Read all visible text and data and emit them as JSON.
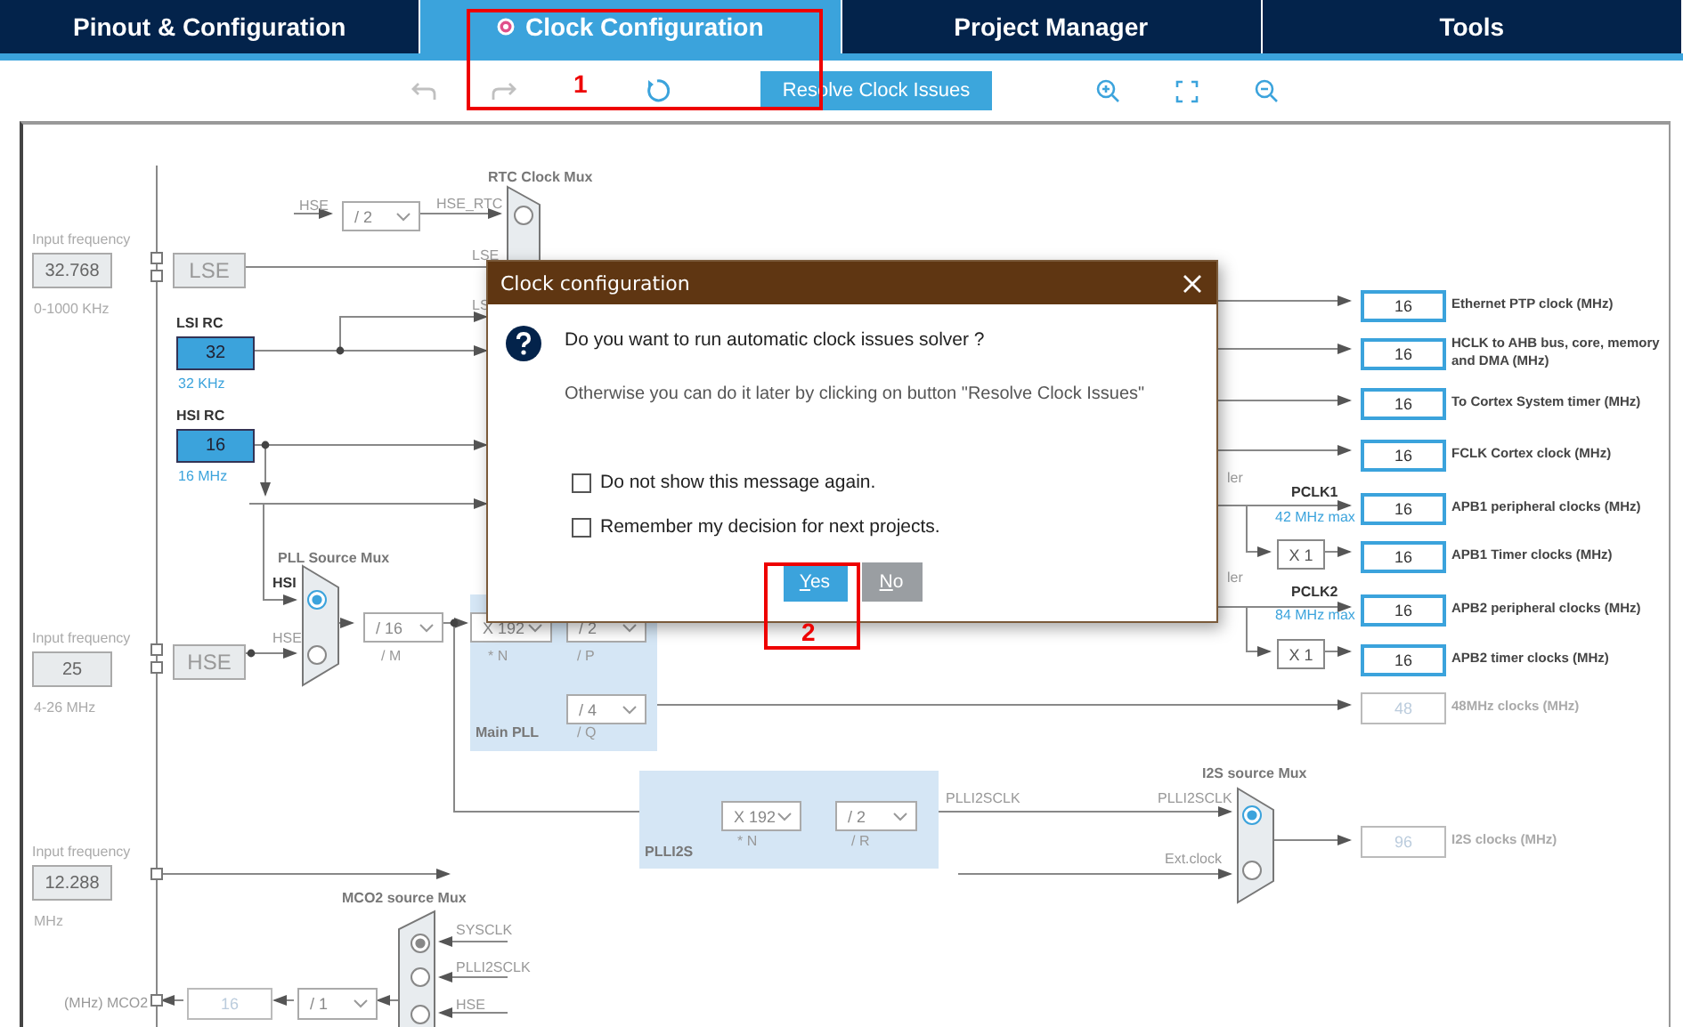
{
  "tabs": [
    {
      "label": "Pinout & Configuration",
      "selected": false
    },
    {
      "label": "Clock Configuration",
      "selected": true
    },
    {
      "label": "Project Manager",
      "selected": false
    },
    {
      "label": "Tools",
      "selected": false
    }
  ],
  "toolbar": {
    "items": [
      {
        "kind": "undo",
        "disabled": true
      },
      {
        "kind": "redo",
        "disabled": true
      },
      {
        "kind": "reset",
        "disabled": false
      },
      {
        "kind": "resolve",
        "label": "Resolve Clock Issues",
        "disabled": false
      },
      {
        "kind": "zoom-in",
        "disabled": false
      },
      {
        "kind": "fit",
        "disabled": false
      },
      {
        "kind": "zoom-out",
        "disabled": false
      }
    ]
  },
  "diagram": {
    "inputs": [
      {
        "title": "Input frequency",
        "value": "32.768",
        "range": "0-1000 KHz"
      },
      {
        "title": "Input frequency",
        "value": "25",
        "range": "4-26 MHz"
      },
      {
        "title": "Input frequency",
        "value": "12.288",
        "range": "MHz"
      }
    ],
    "sources": [
      {
        "label": "LSE"
      },
      {
        "label": "HSE"
      }
    ],
    "oscillators": [
      {
        "name": "LSI RC",
        "value": "32",
        "frequency": "32 KHz"
      },
      {
        "name": "HSI RC",
        "value": "16",
        "frequency": "16 MHz"
      }
    ],
    "labels": [
      {
        "text": "HSE",
        "kind": "wire"
      },
      {
        "text": "HSE_RTC",
        "kind": "wire"
      },
      {
        "text": "RTC Clock Mux",
        "kind": "title"
      },
      {
        "text": "LSE",
        "kind": "wire"
      },
      {
        "text": "LS",
        "kind": "wire"
      },
      {
        "text": "PLL Source Mux",
        "kind": "title"
      },
      {
        "text": "HSI",
        "kind": "dark"
      },
      {
        "text": "HSE",
        "kind": "wire"
      },
      {
        "text": "/ M",
        "kind": "wire"
      },
      {
        "text": "* N",
        "kind": "wire"
      },
      {
        "text": "/ P",
        "kind": "wire"
      },
      {
        "text": "/ Q",
        "kind": "wire"
      },
      {
        "text": "* N",
        "kind": "wire"
      },
      {
        "text": "/ R",
        "kind": "wire"
      },
      {
        "text": "PLLI2SCLK",
        "kind": "wire"
      },
      {
        "text": "PLLI2SCLK",
        "kind": "wire"
      },
      {
        "text": "Ext.clock",
        "kind": "wire"
      },
      {
        "text": "I2S source Mux",
        "kind": "title"
      },
      {
        "text": "MCO2 source Mux",
        "kind": "title"
      },
      {
        "text": "SYSCLK",
        "kind": "wire"
      },
      {
        "text": "PLLI2SCLK",
        "kind": "wire"
      },
      {
        "text": "HSE",
        "kind": "wire"
      },
      {
        "text": "(MHz) MCO2",
        "kind": "wire"
      },
      {
        "text": "ler",
        "kind": "wire"
      },
      {
        "text": "PCLK1",
        "kind": "dark"
      },
      {
        "text": "42 MHz max",
        "kind": "note"
      },
      {
        "text": "ler",
        "kind": "wire"
      },
      {
        "text": "PCLK2",
        "kind": "dark"
      },
      {
        "text": "84 MHz max",
        "kind": "note"
      }
    ],
    "panels": [
      {
        "title": "Main PLL"
      },
      {
        "title": "PLLI2S"
      }
    ],
    "selects": [
      {
        "value": "/ 2"
      },
      {
        "value": "/ 16"
      },
      {
        "value": "X 192"
      },
      {
        "value": "/ 2"
      },
      {
        "value": "/ 4"
      },
      {
        "value": "X 192"
      },
      {
        "value": "/ 2"
      },
      {
        "value": "/ 1"
      }
    ],
    "muxes": [
      {
        "options": [
          {
            "selected": false
          }
        ]
      },
      {
        "options": [
          {
            "selected": true
          },
          {
            "selected": false
          }
        ]
      },
      {
        "options": [
          {
            "selected": true
          },
          {
            "selected": false
          }
        ]
      },
      {
        "options": [
          {
            "selected": true
          },
          {
            "selected": false
          },
          {
            "selected": false
          }
        ]
      }
    ],
    "multipliers": [
      {
        "value": "X 1"
      },
      {
        "value": "X 1"
      }
    ],
    "outputs": [
      {
        "value": "16",
        "label": "Ethernet PTP clock (MHz)",
        "enabled": true
      },
      {
        "value": "16",
        "label": "HCLK to AHB bus, core, memory and DMA (MHz)",
        "enabled": true
      },
      {
        "value": "16",
        "label": "To Cortex System timer (MHz)",
        "enabled": true
      },
      {
        "value": "16",
        "label": "FCLK Cortex clock (MHz)",
        "enabled": true
      },
      {
        "value": "16",
        "label": "APB1 peripheral clocks (MHz)",
        "enabled": true
      },
      {
        "value": "16",
        "label": "APB1 Timer clocks (MHz)",
        "enabled": true
      },
      {
        "value": "16",
        "label": "APB2 peripheral clocks (MHz)",
        "enabled": true
      },
      {
        "value": "16",
        "label": "APB2 timer clocks (MHz)",
        "enabled": true
      },
      {
        "value": "48",
        "label": "48MHz clocks (MHz)",
        "enabled": false
      },
      {
        "value": "96",
        "label": "I2S clocks (MHz)",
        "enabled": false
      }
    ],
    "mco2": {
      "value": "16",
      "enabled": false
    }
  },
  "dialog": {
    "title": "Clock configuration",
    "message": "Do you want to run automatic clock issues solver ?",
    "hint": "Otherwise you can do it later by clicking on button \"Resolve Clock Issues\"",
    "checkboxes": [
      {
        "label": "Do not show this message again.",
        "checked": false
      },
      {
        "label": "Remember my decision for next projects.",
        "checked": false
      }
    ],
    "buttons": [
      {
        "label": "Yes",
        "kind": "primary"
      },
      {
        "label": "No",
        "kind": "secondary"
      }
    ]
  },
  "annotations": [
    {
      "label": "1"
    },
    {
      "label": "2"
    }
  ]
}
